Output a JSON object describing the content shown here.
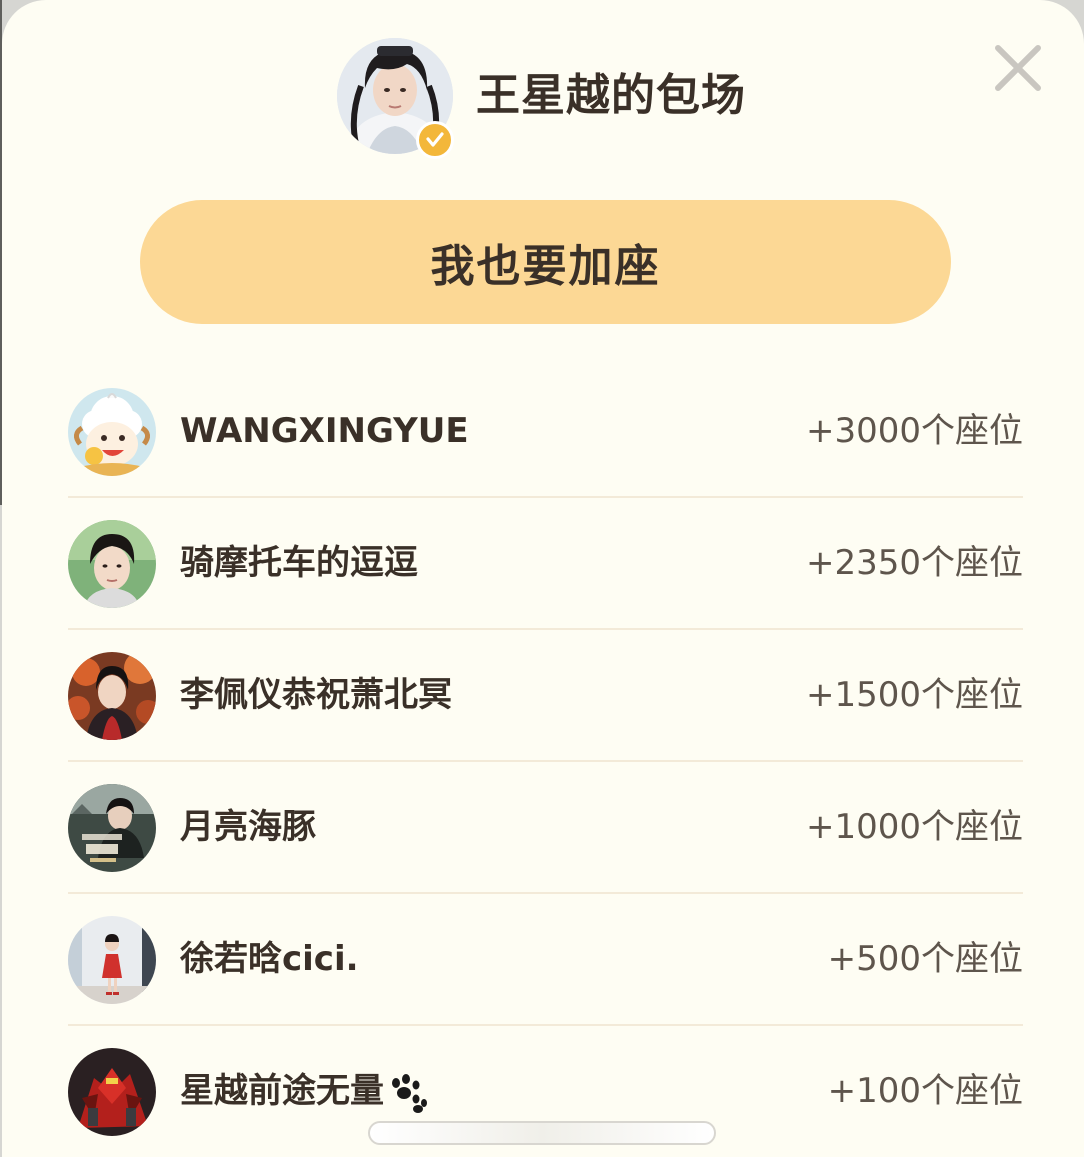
{
  "header": {
    "title": "王星越的包场",
    "host_avatar_icon": "host-portrait-avatar",
    "badge_icon": "verified-check-icon",
    "close_icon": "close-icon"
  },
  "cta": {
    "label": "我也要加座"
  },
  "colors": {
    "background": "#fefdf3",
    "cta_background": "#fcd895",
    "text_primary": "#3a3028",
    "text_secondary": "#5e554c",
    "divider": "#f3ead8",
    "badge": "#f3b73a",
    "close": "#c9c6c0"
  },
  "seat_list": [
    {
      "name": "WANGXINGYUE",
      "seats": "+3000个座位",
      "avatar_icon": "cartoon-sheep-avatar"
    },
    {
      "name": "骑摩托车的逗逗",
      "seats": "+2350个座位",
      "avatar_icon": "portrait-avatar"
    },
    {
      "name": "李佩仪恭祝萧北冥",
      "seats": "+1500个座位",
      "avatar_icon": "costume-portrait-avatar"
    },
    {
      "name": "月亮海豚",
      "seats": "+1000个座位",
      "avatar_icon": "poster-avatar"
    },
    {
      "name": "徐若晗cici.",
      "seats": "+500个座位",
      "avatar_icon": "child-photo-avatar"
    },
    {
      "name": "星越前途无量",
      "seats": "+100个座位",
      "avatar_icon": "mecha-avatar",
      "name_suffix_icon": "paw-print-icon"
    }
  ]
}
